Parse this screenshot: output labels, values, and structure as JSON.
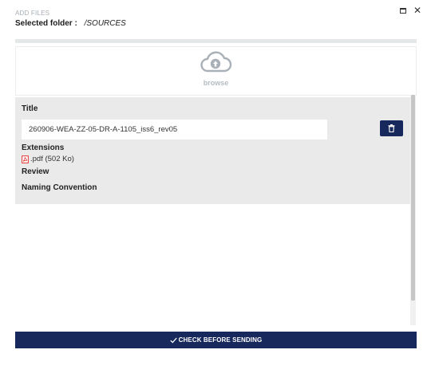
{
  "header": {
    "kicker": "ADD FILES",
    "folder_label": "Selected folder :",
    "folder_value": "/SOURCES"
  },
  "window_controls": {
    "maximize_icon": "maximize-icon",
    "close_icon": "close-icon",
    "close_glyph": "✕"
  },
  "upload": {
    "icon": "cloud-upload-icon",
    "browse_label": "browse"
  },
  "file": {
    "title_label": "Title",
    "title_value": "260906-WEA-ZZ-05-DR-A-1105_iss6_rev05",
    "extensions_label": "Extensions",
    "extension_icon": "pdf-file-icon",
    "extension_text": ".pdf (502 Ko)",
    "review_label": "Review",
    "naming_label": "Naming Convention",
    "delete_icon": "trash-icon"
  },
  "footer": {
    "check_icon": "checkmark-icon",
    "check_label": "CHECK BEFORE SENDING"
  },
  "colors": {
    "primary": "#16285c",
    "panel_bg": "#eaeaea",
    "pdf_red": "#e53935",
    "muted": "#b5bbc2"
  }
}
